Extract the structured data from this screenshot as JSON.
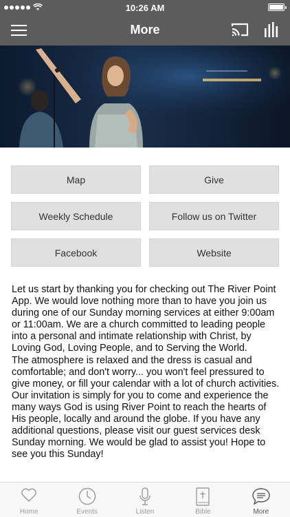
{
  "status_bar": {
    "time": "10:26 AM"
  },
  "nav": {
    "title": "More"
  },
  "hero": {
    "description_icon": "worship-leader-photo"
  },
  "buttons": [
    {
      "label": "Map"
    },
    {
      "label": "Give"
    },
    {
      "label": "Weekly Schedule"
    },
    {
      "label": "Follow us on Twitter"
    },
    {
      "label": "Facebook"
    },
    {
      "label": "Website"
    }
  ],
  "body": {
    "text": "Let us start by thanking you for checking out The River Point App. We would love nothing more than to have you join us during one of our Sunday morning services at either 9:00am or 11:00am. We are a church committed to leading people into a personal and intimate relationship with Christ, by Loving God, Loving People, and to Serving the World.\nThe atmosphere is relaxed and the dress is casual and comfortable; and don't worry... you won't feel pressured to give money, or fill your calendar with a lot of church activities. Our invitation is simply for you to come and experience the many ways God is using River Point to reach the hearts of His people, locally and around the globe.  If you have any additional questions, please visit our guest services desk Sunday morning. We would be glad to assist you! Hope to see you this Sunday!"
  },
  "tabs": [
    {
      "label": "Home",
      "icon": "heart-icon"
    },
    {
      "label": "Events",
      "icon": "clock-icon"
    },
    {
      "label": "Listen",
      "icon": "microphone-icon"
    },
    {
      "label": "Bible",
      "icon": "bible-icon"
    },
    {
      "label": "More",
      "icon": "chat-bubble-icon"
    }
  ],
  "colors": {
    "header": "#5c5c5c",
    "button_bg": "#e0e0e0",
    "tab_inactive": "#9a9a9a",
    "tab_active": "#555555"
  }
}
